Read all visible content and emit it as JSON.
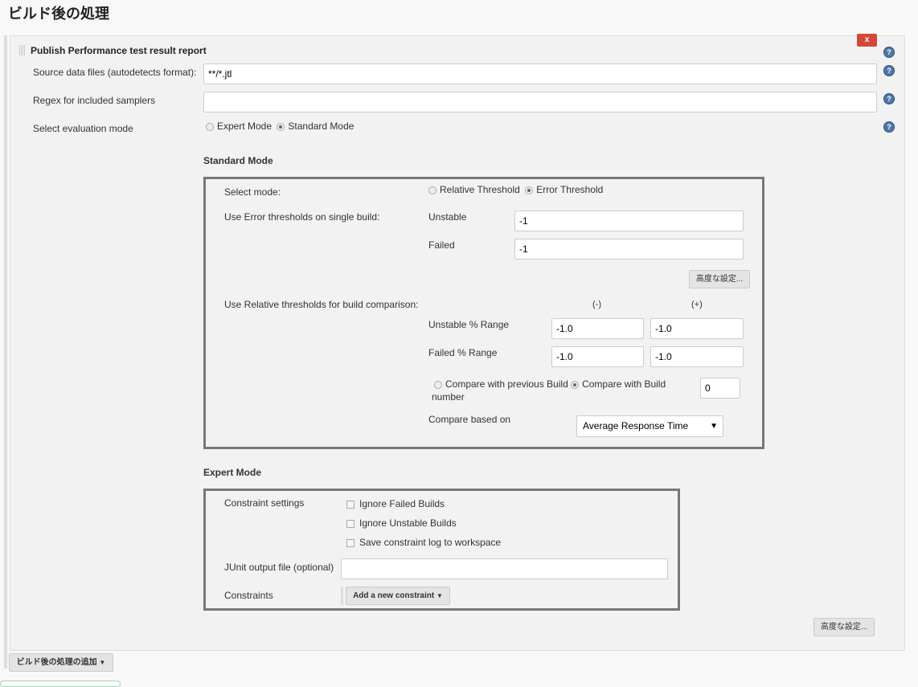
{
  "page_title": "ビルド後の処理",
  "section": {
    "title": "Publish Performance test result report",
    "delete_label": "x",
    "source_label": "Source data files (autodetects format):",
    "source_value": "**/*.jtl",
    "regex_label": "Regex for included samplers",
    "regex_value": "",
    "eval_label": "Select evaluation mode",
    "eval_options": [
      "Expert Mode",
      "Standard Mode"
    ],
    "eval_selected": "Standard Mode",
    "help_icon": "?"
  },
  "standard": {
    "heading": "Standard Mode",
    "select_mode_label": "Select mode:",
    "mode_options": [
      "Relative Threshold",
      "Error Threshold"
    ],
    "mode_selected": "Error Threshold",
    "error_label": "Use Error thresholds on single build:",
    "unstable_label": "Unstable",
    "unstable_value": "-1",
    "failed_label": "Failed",
    "failed_value": "-1",
    "advanced_label": "高度な設定...",
    "relative_label": "Use Relative thresholds for build comparison:",
    "minus_header": "(-)",
    "plus_header": "(+)",
    "unstable_range_label": "Unstable % Range",
    "unstable_minus": "-1.0",
    "unstable_plus": "-1.0",
    "failed_range_label": "Failed % Range",
    "failed_minus": "-1.0",
    "failed_plus": "-1.0",
    "compare_prev_label": "Compare with previous Build",
    "compare_build_label": "Compare with Build",
    "compare_build_label2": "number",
    "compare_selected": "Compare with Build number",
    "build_number": "0",
    "compare_based_label": "Compare based on",
    "compare_based_value": "Average Response Time"
  },
  "expert": {
    "heading": "Expert Mode",
    "constraint_settings_label": "Constraint settings",
    "checks": [
      {
        "label": "Ignore Failed Builds",
        "checked": false
      },
      {
        "label": "Ignore Unstable Builds",
        "checked": false
      },
      {
        "label": "Save constraint log to workspace",
        "checked": false
      }
    ],
    "junit_label": "JUnit output file (optional)",
    "junit_value": "",
    "constraints_label": "Constraints",
    "add_constraint_label": "Add a new constraint"
  },
  "advanced_label": "高度な設定...",
  "add_post_build_label": "ビルド後の処理の追加"
}
